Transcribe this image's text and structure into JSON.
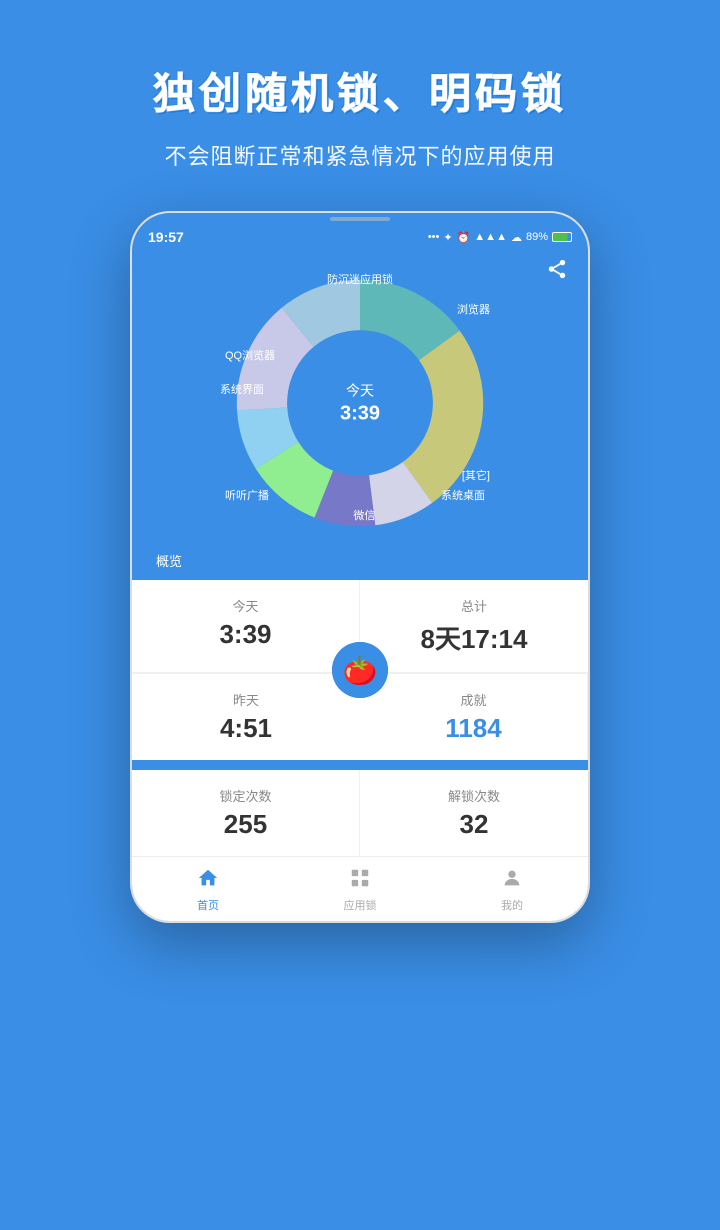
{
  "header": {
    "title": "独创随机锁、明码锁",
    "subtitle": "不会阻断正常和紧急情况下的应用使用"
  },
  "phone": {
    "statusBar": {
      "time": "19:57",
      "battery": "89%",
      "icons": "... ✦ ⏰ ▲ ☁ 89%"
    },
    "chart": {
      "centerLabel": "今天",
      "centerTime": "3:39",
      "shareIcon": "share",
      "overviewLabel": "概览",
      "segments": [
        {
          "label": "防沉迷应用锁",
          "color": "#5eb8b8",
          "value": 15
        },
        {
          "label": "浏览器",
          "color": "#c8c87a",
          "value": 25
        },
        {
          "label": "[其它]",
          "color": "#d4d4e8",
          "value": 8
        },
        {
          "label": "系统桌面",
          "color": "#7878c8",
          "value": 8
        },
        {
          "label": "微信",
          "color": "#90ee90",
          "value": 10
        },
        {
          "label": "听听广播",
          "color": "#90d0f0",
          "value": 8
        },
        {
          "label": "系统界面",
          "color": "#c8c8e8",
          "value": 15
        },
        {
          "label": "QQ浏览器",
          "color": "#a0c8e0",
          "value": 11
        }
      ]
    },
    "stats": {
      "today": {
        "label": "今天",
        "value": "3:39"
      },
      "total": {
        "label": "总计",
        "value": "8天17:14"
      },
      "yesterday": {
        "label": "昨天",
        "value": "4:51"
      },
      "achievement": {
        "label": "成就",
        "value": "1184"
      }
    },
    "lockStats": {
      "lockCount": {
        "label": "锁定次数",
        "value": "255"
      },
      "unlockCount": {
        "label": "解锁次数",
        "value": "32"
      }
    },
    "nav": {
      "items": [
        {
          "label": "首页",
          "icon": "home",
          "active": true
        },
        {
          "label": "应用锁",
          "icon": "grid",
          "active": false
        },
        {
          "label": "我的",
          "icon": "person",
          "active": false
        }
      ]
    }
  }
}
